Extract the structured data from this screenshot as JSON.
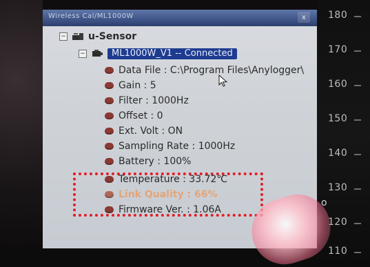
{
  "window": {
    "title": "Wireless Cal/ML1000W",
    "close_symbol": "x"
  },
  "tree": {
    "root_label": "u-Sensor",
    "device": {
      "label": "ML1000W_V1 -- Connected",
      "properties": [
        "Data File : C:\\Program Files\\Anylogger\\",
        "Gain : 5",
        "Filter : 1000Hz",
        "Offset : 0",
        "Ext. Volt : ON",
        "Sampling Rate : 1000Hz",
        "Battery : 100%",
        "Temperature : 33.72℃",
        "Link Quality : 66%",
        "Firmware Ver. : 1.06A"
      ]
    }
  },
  "gauge": {
    "ticks": [
      "180",
      "170",
      "160",
      "150",
      "140",
      "130",
      "120",
      "110"
    ],
    "unit": "o"
  },
  "colors": {
    "highlight": "#e51b24",
    "selection": "#1e3c8f"
  }
}
